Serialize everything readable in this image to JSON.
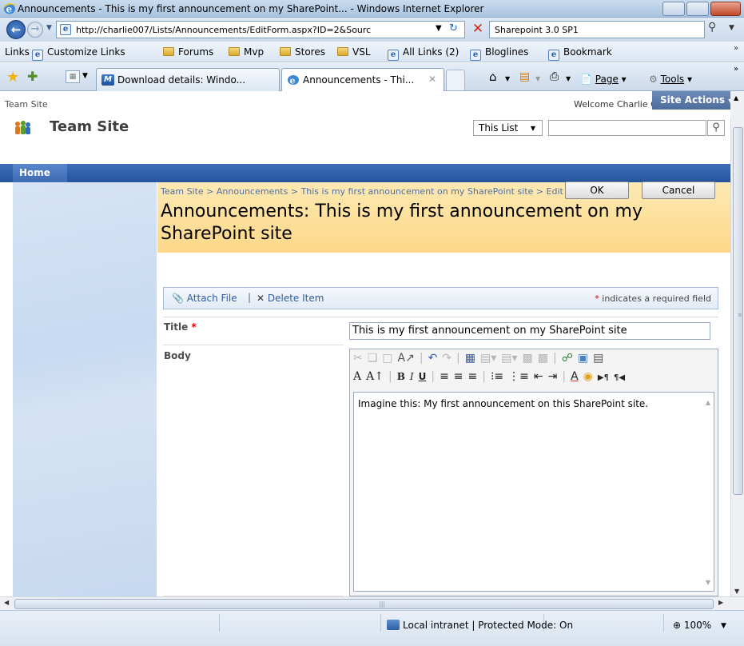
{
  "window": {
    "title": "Announcements - This is my first announcement on my SharePoint... - Windows Internet Explorer"
  },
  "address_bar": {
    "url": "http://charlie007/Lists/Announcements/EditForm.aspx?ID=2&Sourc",
    "search_text": "Sharepoint 3.0 SP1"
  },
  "links_bar": {
    "label": "Links",
    "items": [
      "Customize Links",
      "Forums",
      "Mvp",
      "Stores",
      "VSL",
      "All Links (2)",
      "Bloglines",
      "Bookmark"
    ]
  },
  "tabs": [
    {
      "label": "Download details: Windo..."
    },
    {
      "label": "Announcements - Thi..."
    }
  ],
  "command_bar": {
    "page": "Page",
    "tools": "Tools"
  },
  "sharepoint": {
    "top_crumb": "Team Site",
    "welcome": "Welcome Charlie Calvert",
    "site_title": "Team Site",
    "search_scope": "This List",
    "nav_home": "Home",
    "site_actions": "Site Actions",
    "breadcrumb": "Team Site > Announcements > This is my first announcement on my SharePoint site > Edit Item",
    "page_title": "Announcements: This is my first announcement on my SharePoint site",
    "ok_label": "OK",
    "cancel_label": "Cancel",
    "attach_file": "Attach File",
    "delete_item": "Delete Item",
    "required_note": "indicates a required field",
    "required_star": "*",
    "fields": {
      "title_label": "Title",
      "title_value": "This is my first announcement on my SharePoint site",
      "body_label": "Body",
      "body_value": "Imagine this: My first announcement on this SharePoint site."
    }
  },
  "status_bar": {
    "zone": "Local intranet | Protected Mode: On",
    "zoom": "100%"
  }
}
